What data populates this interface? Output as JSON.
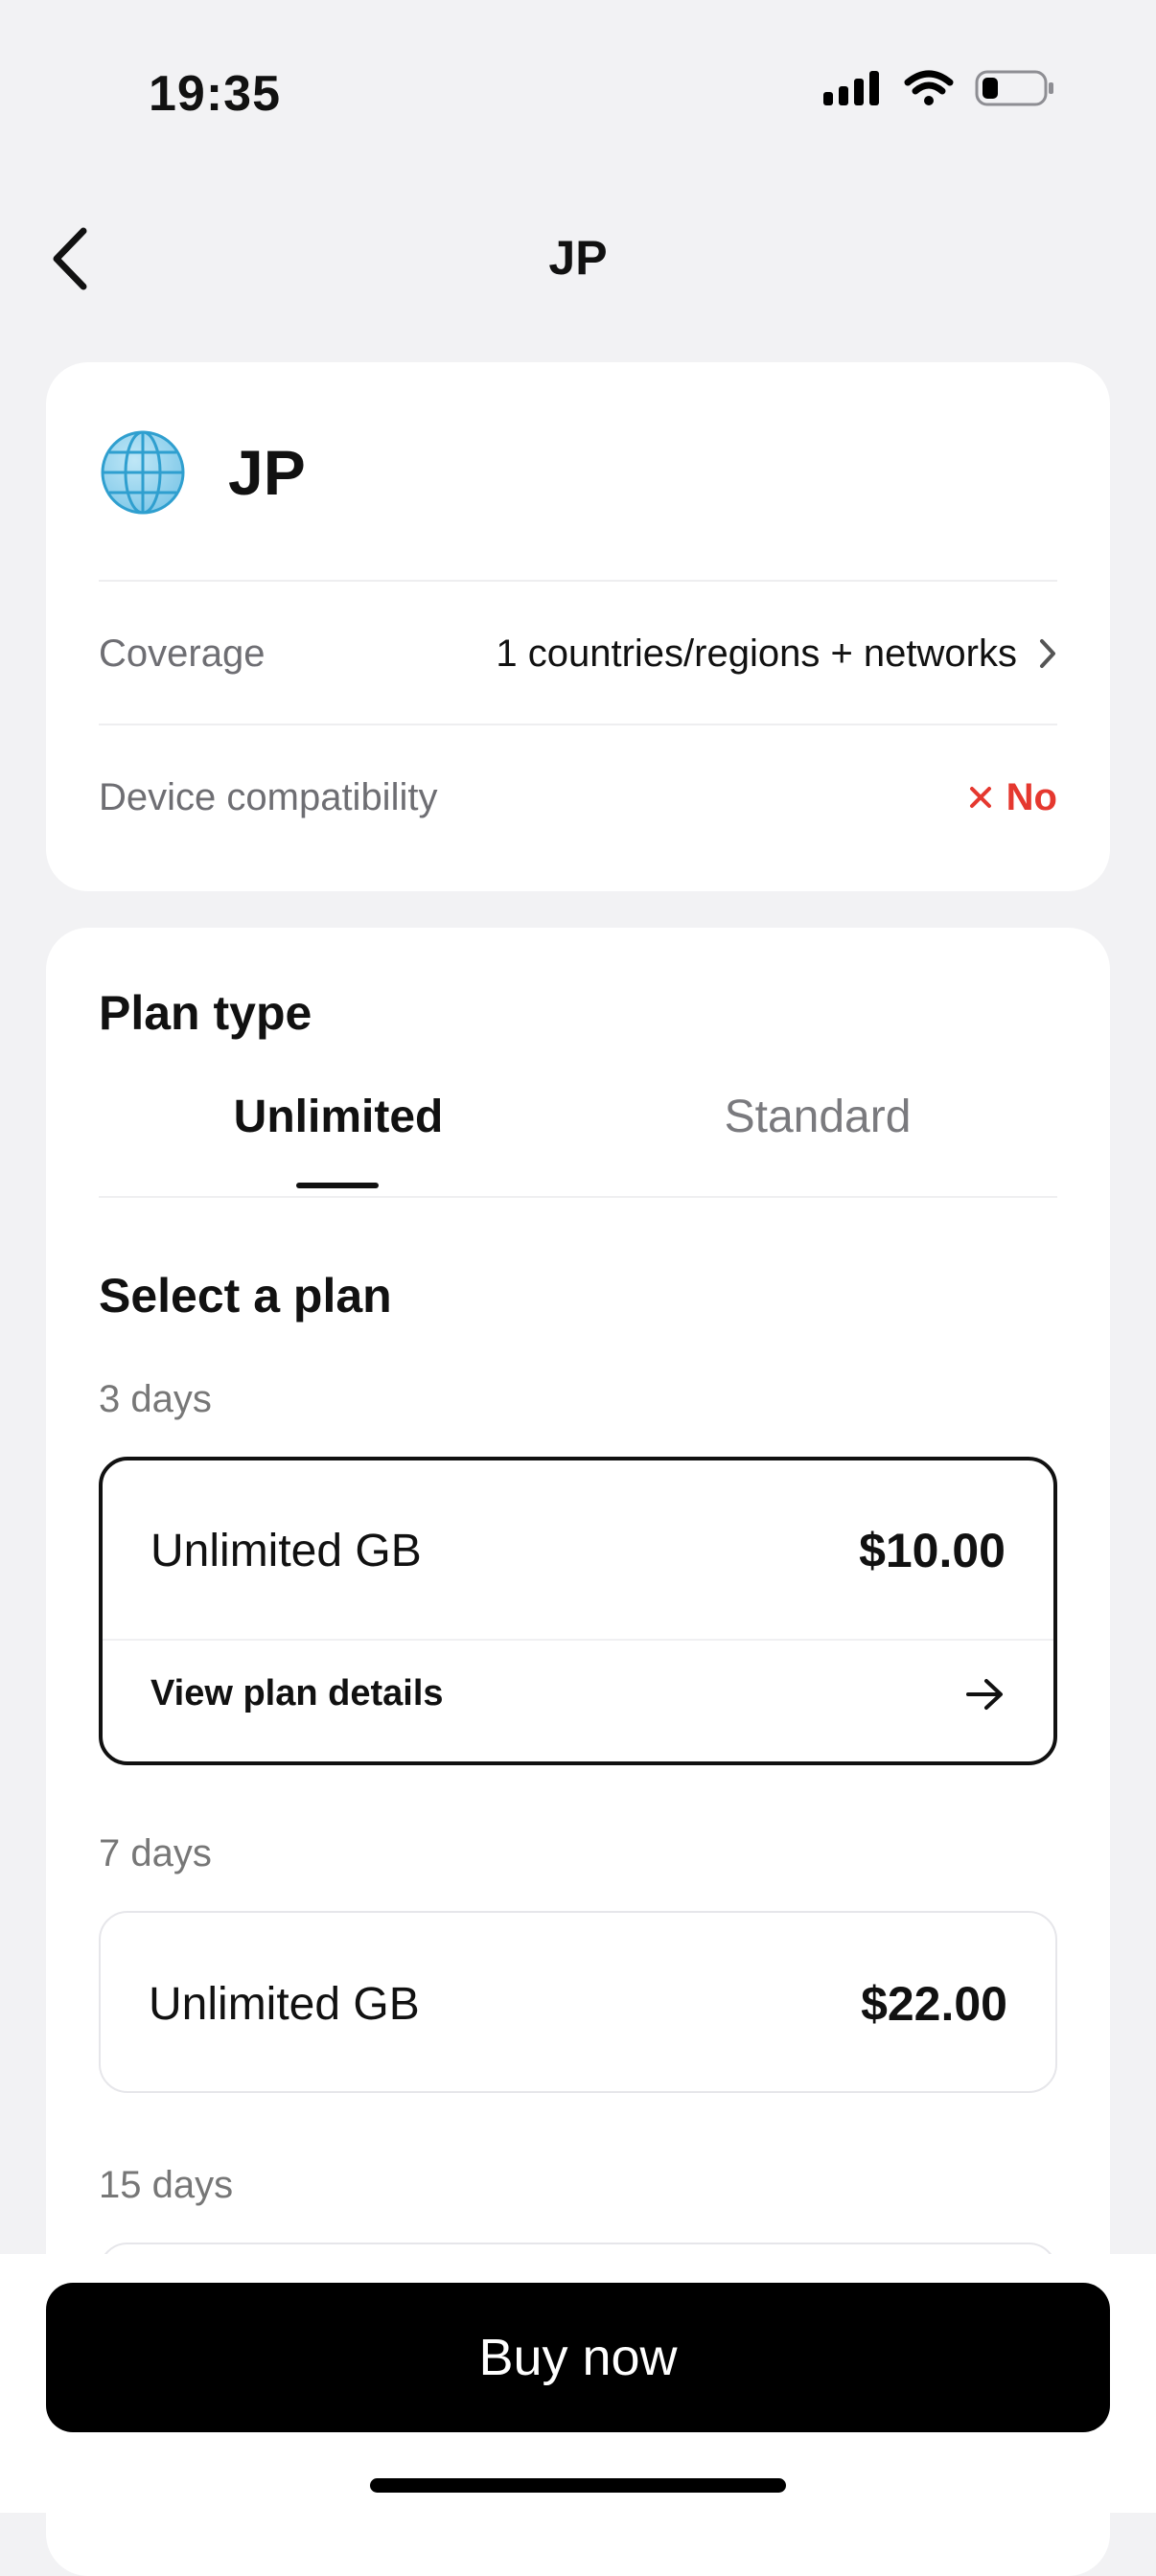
{
  "status_bar": {
    "time": "19:35"
  },
  "nav": {
    "title": "JP"
  },
  "product": {
    "name": "JP",
    "coverage_label": "Coverage",
    "coverage_value": "1 countries/regions + networks",
    "compat_label": "Device compatibility",
    "compat_value": "No",
    "compat_color": "#e5382f"
  },
  "plan_type": {
    "title": "Plan type",
    "tabs": [
      {
        "label": "Unlimited",
        "active": true
      },
      {
        "label": "Standard",
        "active": false
      }
    ]
  },
  "select_plan": {
    "title": "Select a plan",
    "groups": [
      {
        "duration": "3 days",
        "plan_name": "Unlimited GB",
        "price": "$10.00",
        "selected": true,
        "details_label": "View plan details"
      },
      {
        "duration": "7 days",
        "plan_name": "Unlimited GB",
        "price": "$22.00",
        "selected": false
      },
      {
        "duration": "15 days"
      }
    ]
  },
  "footer": {
    "buy_label": "Buy now"
  },
  "icons": [
    "chevron-left-icon",
    "globe-icon",
    "chevron-right-icon",
    "close-icon",
    "arrow-right-icon",
    "signal-icon",
    "wifi-icon",
    "battery-icon"
  ]
}
